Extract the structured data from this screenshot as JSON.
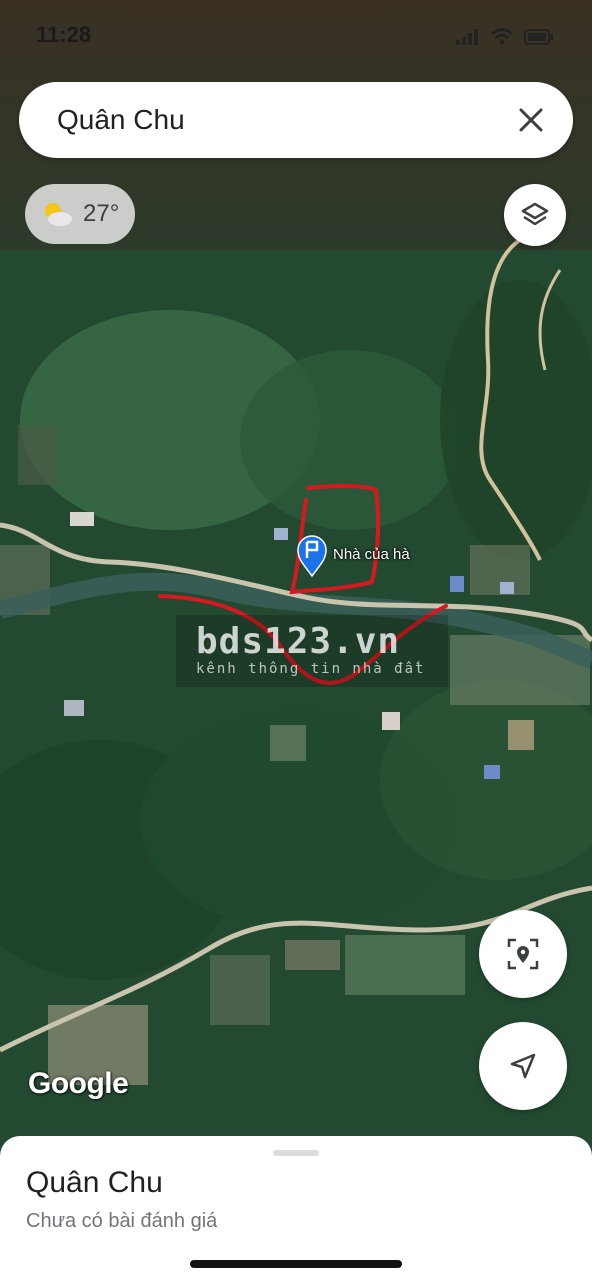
{
  "status_bar": {
    "time": "11:28"
  },
  "search": {
    "query": "Quân Chu"
  },
  "weather": {
    "temperature": "27°",
    "icon": "partly-cloudy-icon"
  },
  "map": {
    "marker_label": "Nhà của hà",
    "attribution": "Google",
    "watermark_title": "bds123.vn",
    "watermark_subtitle": "kênh thông tin nhà đất"
  },
  "controls": {
    "layers_icon": "layers-icon",
    "recenter_icon": "my-location-icon",
    "navigate_icon": "navigation-arrow-icon",
    "close_icon": "close-icon"
  },
  "place_sheet": {
    "title": "Quân Chu",
    "subtitle": "Chưa có bài đánh giá"
  },
  "colors": {
    "annotation": "#d7191f",
    "marker": "#1a73e8"
  }
}
